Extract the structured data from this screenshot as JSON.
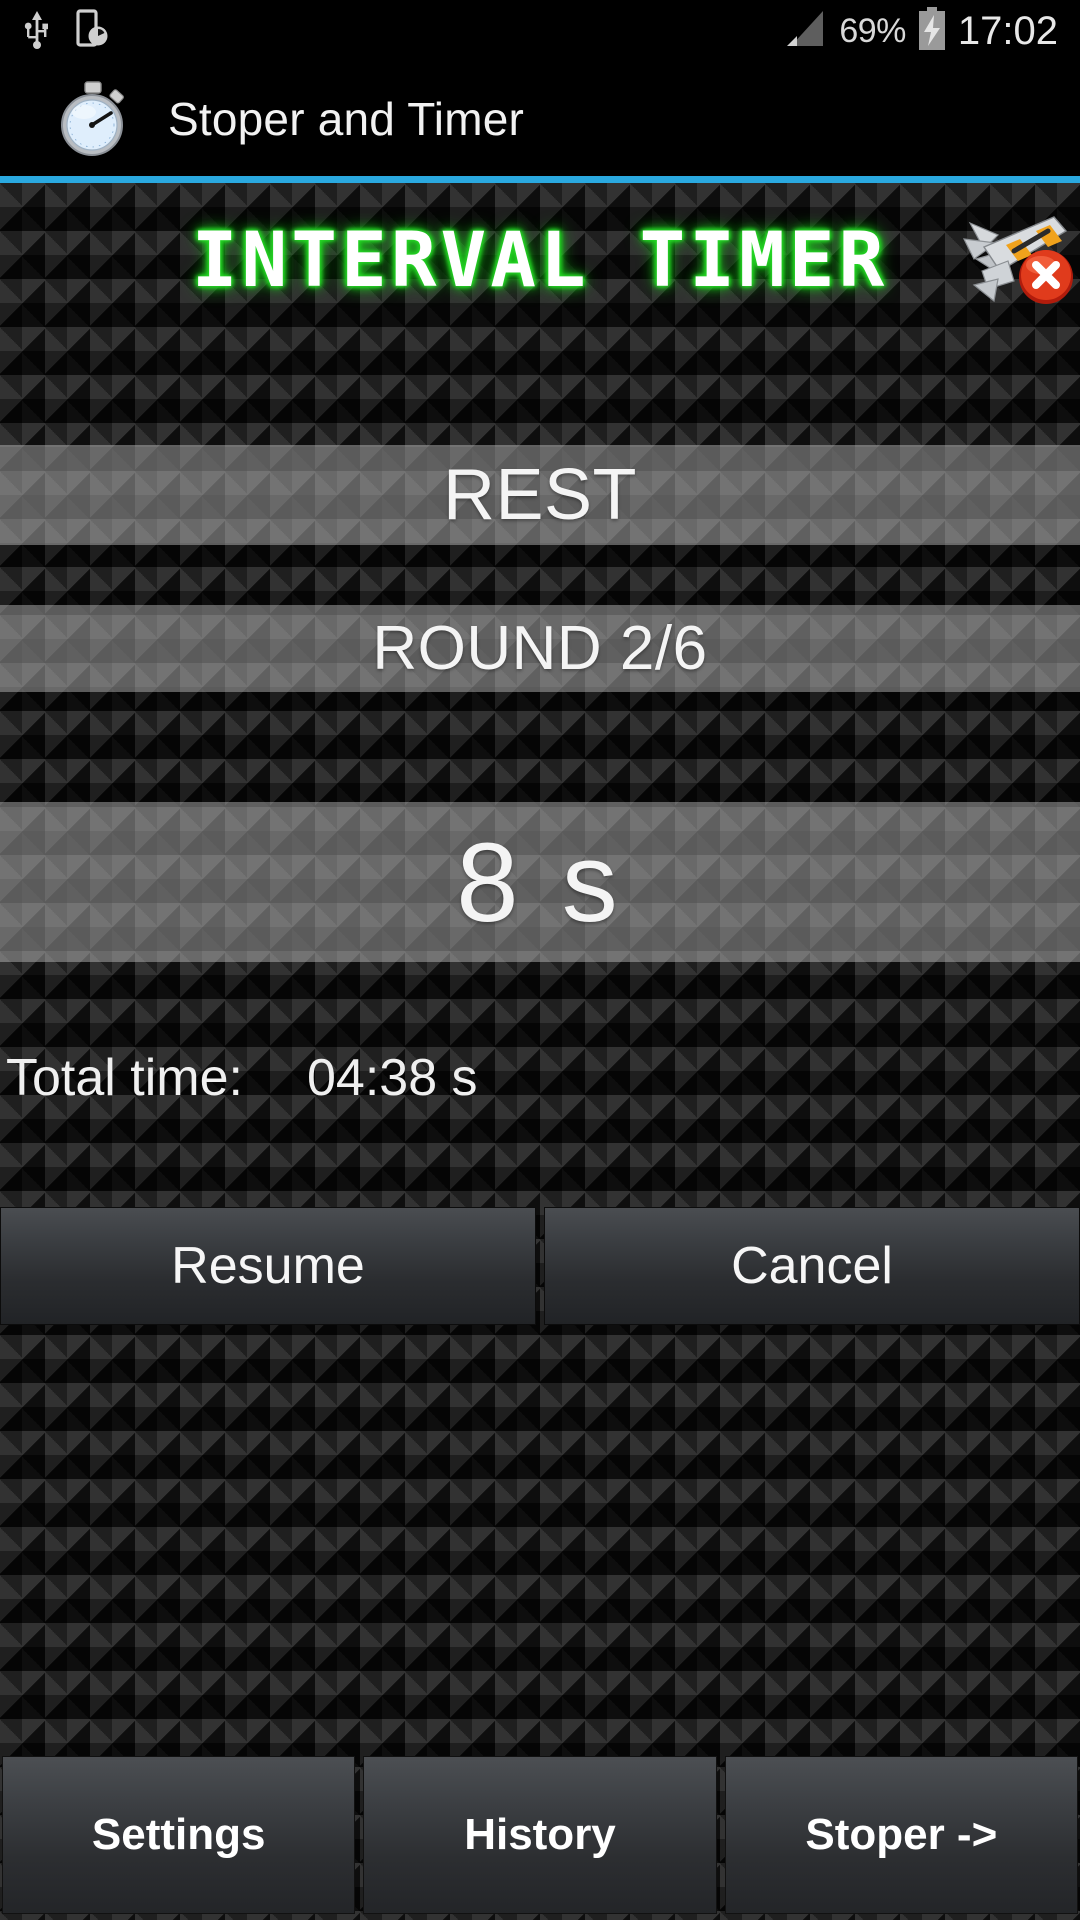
{
  "status_bar": {
    "icons": [
      "usb-icon",
      "device-clock-icon",
      "signal-icon"
    ],
    "battery_percent": "69%",
    "battery_state": "charging",
    "time": "17:02"
  },
  "action_bar": {
    "icon": "stopwatch-icon",
    "title": "Stoper and Timer"
  },
  "accent_color": "#2aa9e0",
  "screen": {
    "title": "INTERVAL  TIMER",
    "title_glow_color": "#23c523",
    "sound_button": {
      "icon": "horn-mute-icon",
      "badge": "x",
      "badge_color": "#d5301c"
    },
    "phase": "REST",
    "round": "ROUND 2/6",
    "countdown": "8 s",
    "total_time_label": "Total time:",
    "total_time_value": "04:38 s"
  },
  "controls": {
    "resume_label": "Resume",
    "cancel_label": "Cancel"
  },
  "bottom_nav": {
    "settings_label": "Settings",
    "history_label": "History",
    "stoper_label": "Stoper ->"
  }
}
